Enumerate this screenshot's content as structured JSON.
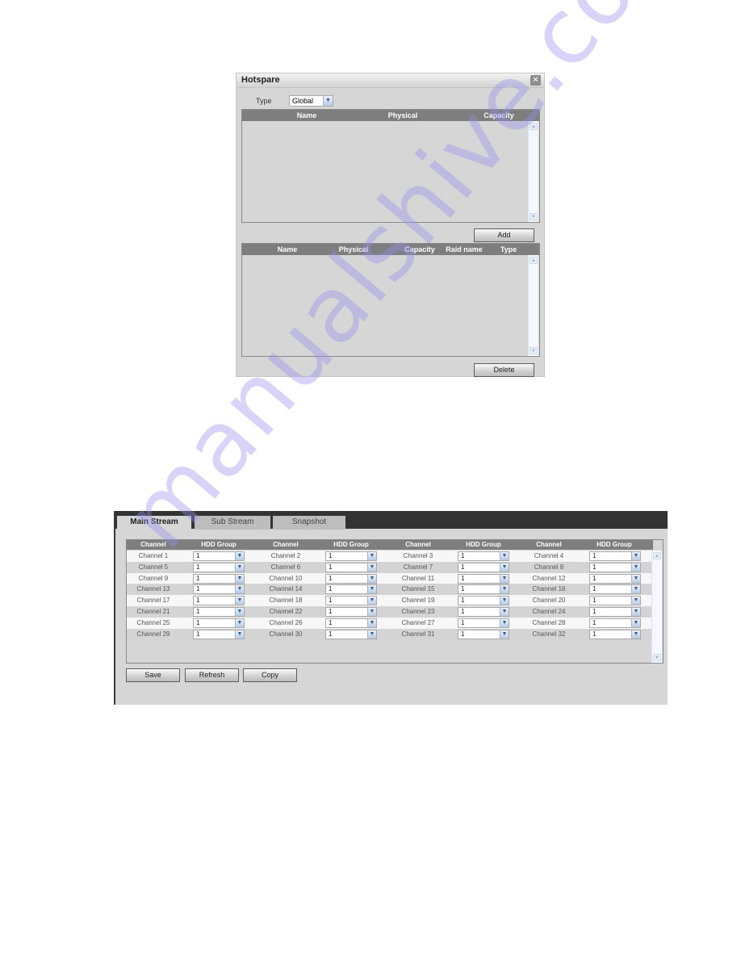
{
  "hotspare": {
    "title": "Hotspare",
    "close_icon": "close-icon",
    "type_label": "Type",
    "type_value": "Global",
    "available_table": {
      "columns": [
        "Name",
        "Physical",
        "Capacity"
      ],
      "rows": []
    },
    "add_label": "Add",
    "hotspare_table": {
      "columns": [
        "Name",
        "Physical",
        "Capacity",
        "Raid name",
        "Type"
      ],
      "rows": []
    },
    "delete_label": "Delete"
  },
  "storage": {
    "tabs": [
      {
        "label": "Main Stream",
        "active": true
      },
      {
        "label": "Sub Stream",
        "active": false
      },
      {
        "label": "Snapshot",
        "active": false
      }
    ],
    "columns": [
      "Channel",
      "HDD Group",
      "Channel",
      "HDD Group",
      "Channel",
      "HDD Group",
      "Channel",
      "HDD Group"
    ],
    "rows": [
      [
        {
          "channel": "Channel 1",
          "group": "1"
        },
        {
          "channel": "Channel 2",
          "group": "1"
        },
        {
          "channel": "Channel 3",
          "group": "1"
        },
        {
          "channel": "Channel 4",
          "group": "1"
        }
      ],
      [
        {
          "channel": "Channel 5",
          "group": "1"
        },
        {
          "channel": "Channel 6",
          "group": "1"
        },
        {
          "channel": "Channel 7",
          "group": "1"
        },
        {
          "channel": "Channel 8",
          "group": "1"
        }
      ],
      [
        {
          "channel": "Channel 9",
          "group": "1"
        },
        {
          "channel": "Channel 10",
          "group": "1"
        },
        {
          "channel": "Channel 11",
          "group": "1"
        },
        {
          "channel": "Channel 12",
          "group": "1"
        }
      ],
      [
        {
          "channel": "Channel 13",
          "group": "1"
        },
        {
          "channel": "Channel 14",
          "group": "1"
        },
        {
          "channel": "Channel 15",
          "group": "1"
        },
        {
          "channel": "Channel 16",
          "group": "1"
        }
      ],
      [
        {
          "channel": "Channel 17",
          "group": "1"
        },
        {
          "channel": "Channel 18",
          "group": "1"
        },
        {
          "channel": "Channel 19",
          "group": "1"
        },
        {
          "channel": "Channel 20",
          "group": "1"
        }
      ],
      [
        {
          "channel": "Channel 21",
          "group": "1"
        },
        {
          "channel": "Channel 22",
          "group": "1"
        },
        {
          "channel": "Channel 23",
          "group": "1"
        },
        {
          "channel": "Channel 24",
          "group": "1"
        }
      ],
      [
        {
          "channel": "Channel 25",
          "group": "1"
        },
        {
          "channel": "Channel 26",
          "group": "1"
        },
        {
          "channel": "Channel 27",
          "group": "1"
        },
        {
          "channel": "Channel 28",
          "group": "1"
        }
      ],
      [
        {
          "channel": "Channel 29",
          "group": "1"
        },
        {
          "channel": "Channel 30",
          "group": "1"
        },
        {
          "channel": "Channel 31",
          "group": "1"
        },
        {
          "channel": "Channel 32",
          "group": "1"
        }
      ]
    ],
    "buttons": {
      "save": "Save",
      "refresh": "Refresh",
      "copy": "Copy"
    }
  },
  "watermark": "manualshive.com",
  "colors": {
    "panel_bg": "#d6d6d6",
    "header_bg": "#7e7e7e",
    "topbar_bg": "#333333",
    "value_text": "#3b0057"
  }
}
